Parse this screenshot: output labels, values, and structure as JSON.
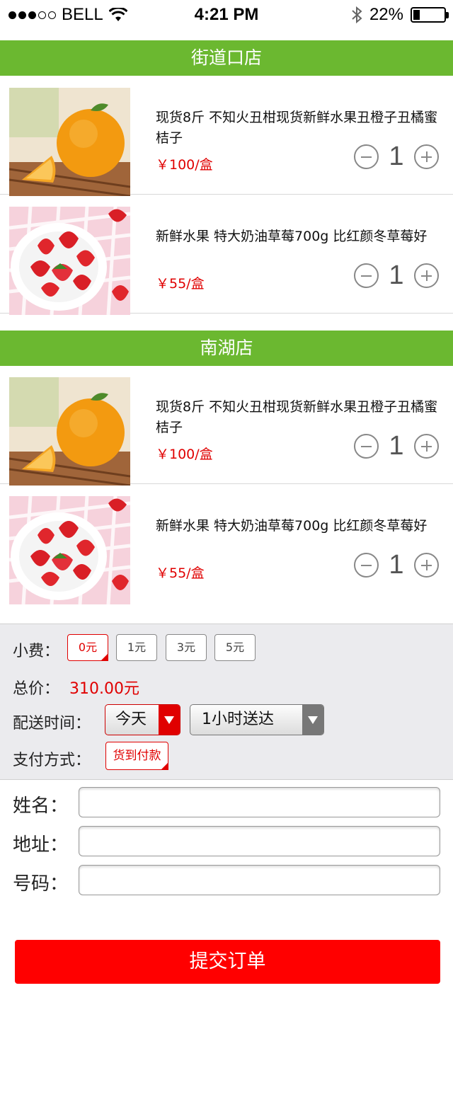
{
  "status_bar": {
    "carrier": "BELL",
    "time": "4:21 PM",
    "battery": "22%",
    "battery_level": 0.22
  },
  "stores": [
    {
      "name": "街道口店",
      "items": [
        {
          "title": "现货8斤 不知火丑柑现货新鲜水果丑橙子丑橘蜜桔子",
          "price": "￥100/盒",
          "qty": "1",
          "image": "orange"
        },
        {
          "title": "新鲜水果 特大奶油草莓700g 比红颜冬草莓好",
          "price": "￥55/盒",
          "qty": "1",
          "image": "strawberry"
        }
      ]
    },
    {
      "name": "南湖店",
      "items": [
        {
          "title": "现货8斤 不知火丑柑现货新鲜水果丑橙子丑橘蜜桔子",
          "price": "￥100/盒",
          "qty": "1",
          "image": "orange"
        },
        {
          "title": "新鲜水果 特大奶油草莓700g 比红颜冬草莓好",
          "price": "￥55/盒",
          "qty": "1",
          "image": "strawberry"
        }
      ]
    }
  ],
  "options": {
    "tip_label": "小费：",
    "tips": [
      "0元",
      "1元",
      "3元",
      "5元"
    ],
    "tip_selected": "0元",
    "total_label": "总价：",
    "total_value": "310.00元",
    "delivery_label": "配送时间：",
    "delivery_day": "今天",
    "delivery_window": "1小时送达",
    "payment_label": "支付方式：",
    "payment_method": "货到付款"
  },
  "form": {
    "name_label": "姓名：",
    "address_label": "地址：",
    "phone_label": "号码："
  },
  "submit_label": "提交订单",
  "colors": {
    "brand_green": "#6bb830",
    "accent_red": "#ff0000",
    "price_red": "#e00000"
  }
}
